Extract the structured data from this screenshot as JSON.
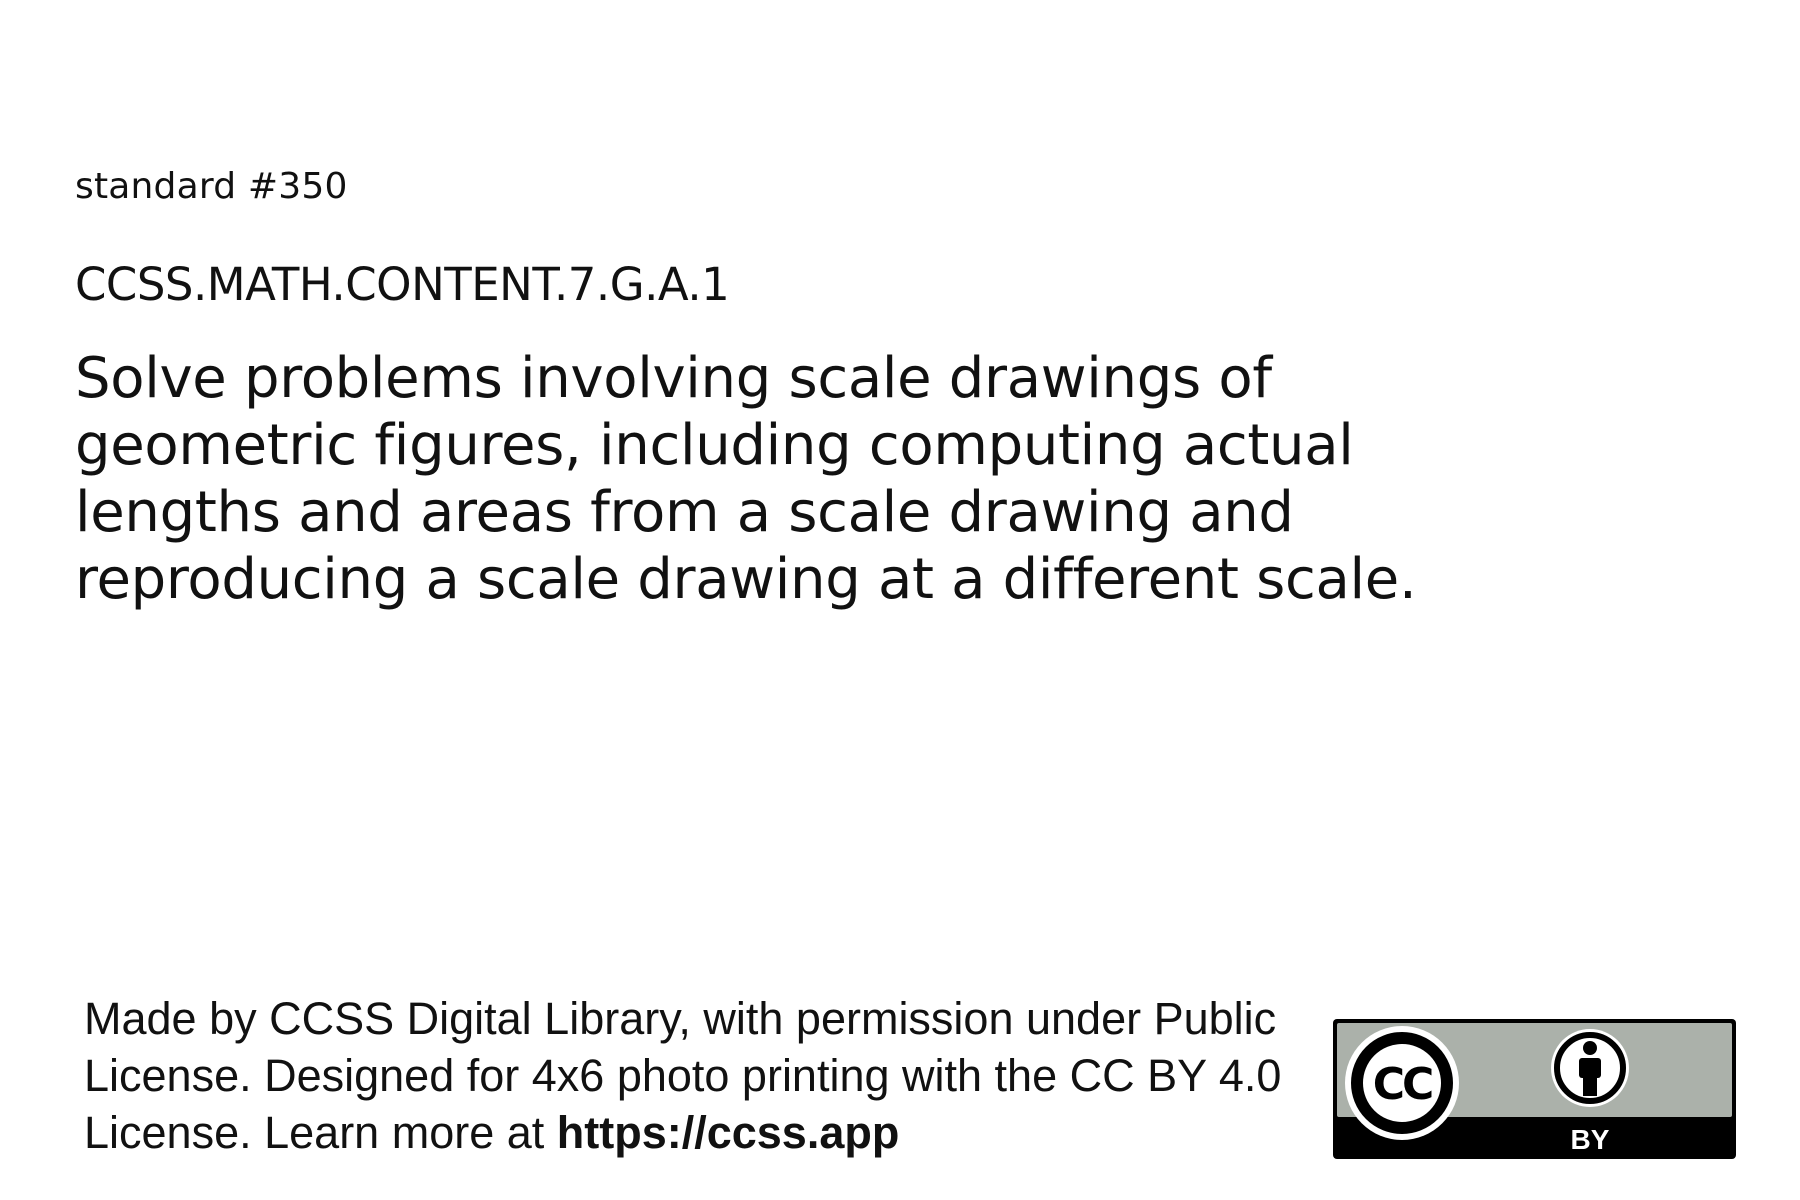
{
  "card": {
    "standard_number": "standard #350",
    "standard_code": "CCSS.MATH.CONTENT.7.G.A.1",
    "description": "Solve problems involving scale drawings of geometric figures, including computing actual lengths and areas from a scale drawing and reproducing a scale drawing at a different scale."
  },
  "footer": {
    "attribution_text": "Made by CCSS Digital Library, with permission under Public License. Designed for 4x6 photo printing with the CC BY 4.0 License. Learn more at ",
    "url": "https://ccss.app"
  },
  "license_badge": {
    "cc_label": "CC",
    "by_label": "BY",
    "colors": {
      "badge_gray": "#abb1aa",
      "badge_black": "#000000",
      "badge_white": "#ffffff"
    }
  }
}
